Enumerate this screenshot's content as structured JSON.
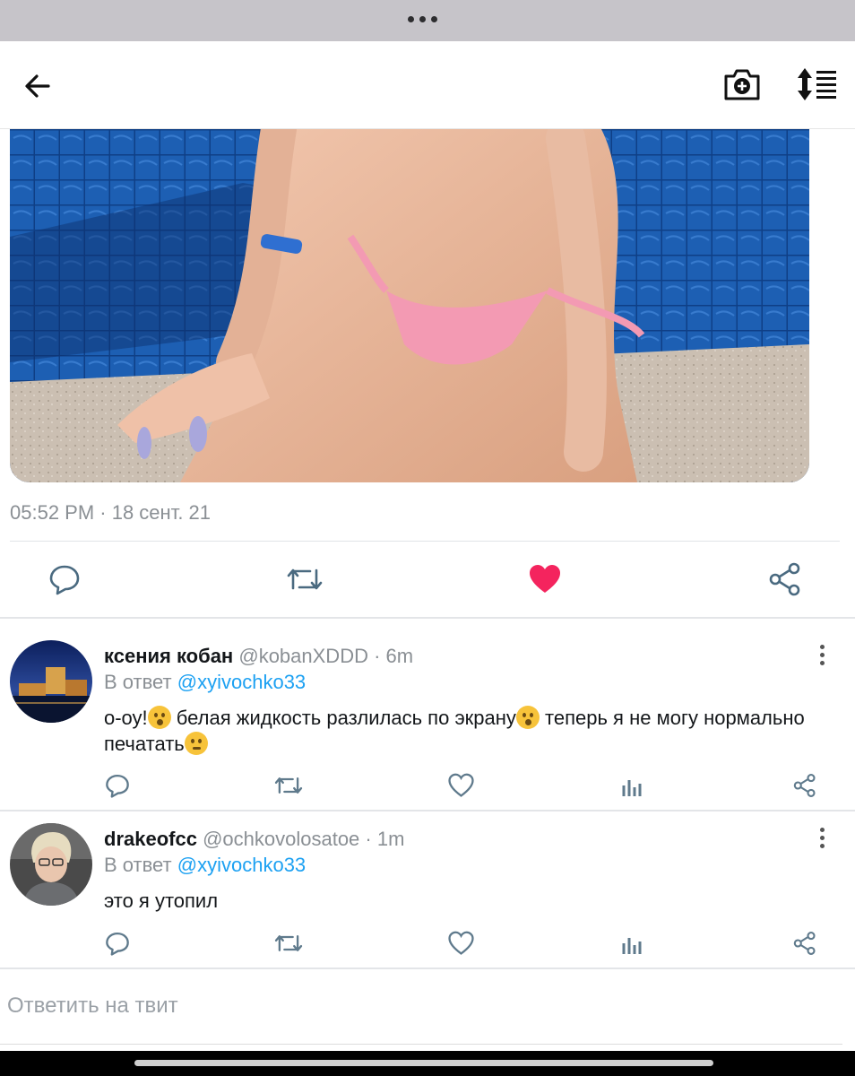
{
  "window": {
    "menu_icon": "more-dots-icon"
  },
  "header": {
    "back_icon": "arrow-left-icon",
    "camera_icon": "camera-plus-icon",
    "sort_icon": "sort-list-icon"
  },
  "tweet": {
    "media_icon": "photo",
    "timestamp": "05:52 PM · 18 сент. 21",
    "actions": {
      "reply_icon": "comment-icon",
      "retweet_icon": "retweet-icon",
      "like_icon": "heart-filled-icon",
      "share_icon": "share-icon",
      "liked_color": "#f4245e"
    }
  },
  "replies": [
    {
      "name": "ксения кобан",
      "handle": "@kobanXDDD",
      "time": "· 6m",
      "reply_to_label": "В ответ",
      "reply_to_handle": "@xyivochko33",
      "text_part1": "о-оу!",
      "text_part2": " белая жидкость разлилась по экрану",
      "text_part3": " теперь я не могу нормально печатать",
      "emojis": [
        "astonished-face-icon",
        "anguished-face-icon",
        "confounded-face-icon"
      ]
    },
    {
      "name": "drakeofcc",
      "handle": "@ochkovolosatoe",
      "time": "· 1m",
      "reply_to_label": "В ответ",
      "reply_to_handle": "@xyivochko33",
      "text": "это я утопил"
    }
  ],
  "reply_input": {
    "placeholder": "Ответить на твит"
  },
  "colors": {
    "accent": "#1da1f2",
    "muted": "#8a8f94",
    "like": "#f4245e"
  }
}
